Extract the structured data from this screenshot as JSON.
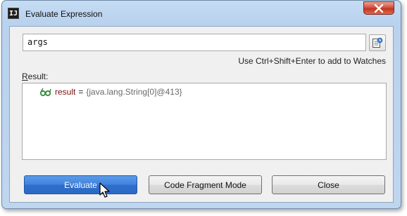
{
  "window": {
    "title": "Evaluate Expression",
    "app_icon": "intellij-idea-icon",
    "close_icon": "close-icon"
  },
  "expression": {
    "value": "args",
    "history_icon": "expression-history-icon"
  },
  "hint": "Use Ctrl+Shift+Enter to add to Watches",
  "result": {
    "label_mnemonic": "R",
    "label_rest": "esult:",
    "items": [
      {
        "icon": "watch-glasses-icon",
        "name": "result",
        "equals": "=",
        "value": "{java.lang.String[0]@413}"
      }
    ]
  },
  "buttons": {
    "evaluate": "Evaluate",
    "code_fragment": "Code Fragment Mode",
    "close": "Close"
  },
  "colors": {
    "primary_button": "#3f82de",
    "result_name": "#7a1010",
    "result_value": "#6a6a6a",
    "close_button": "#c2351f"
  },
  "mouse_cursor": "arrow-cursor-icon"
}
